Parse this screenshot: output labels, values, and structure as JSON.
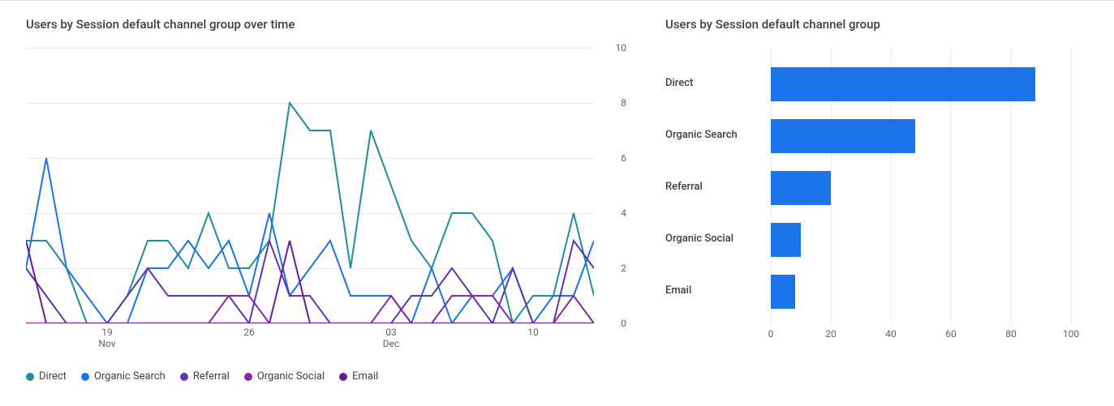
{
  "left": {
    "title": "Users by Session default channel group over time"
  },
  "right": {
    "title": "Users by Session default channel group"
  },
  "legend": {
    "direct": "Direct",
    "organic_search": "Organic Search",
    "referral": "Referral",
    "organic_social": "Organic Social",
    "email": "Email"
  },
  "colors": {
    "direct": "#1e8e9e",
    "organic_search": "#1a73e8",
    "referral": "#5e35b1",
    "organic_social": "#8e24aa",
    "email": "#6a1b9a",
    "bar": "#1a73e8",
    "grid": "#e8eaed",
    "text": "#5f6368"
  },
  "chart_data": [
    {
      "type": "line",
      "title": "Users by Session default channel group over time",
      "xlabel": "",
      "ylabel": "",
      "ylim": [
        0,
        10
      ],
      "y_ticks": [
        0,
        2,
        4,
        6,
        8,
        10
      ],
      "x_ticks": [
        {
          "pos": 4,
          "label": "19",
          "sub": "Nov"
        },
        {
          "pos": 11,
          "label": "26",
          "sub": ""
        },
        {
          "pos": 18,
          "label": "03",
          "sub": "Dec"
        },
        {
          "pos": 25,
          "label": "10",
          "sub": ""
        }
      ],
      "n_points": 29,
      "series": [
        {
          "name": "Direct",
          "color": "#1e8e9e",
          "values": [
            3,
            3,
            2,
            0,
            0,
            1,
            3,
            3,
            2,
            4,
            2,
            2,
            3,
            8,
            7,
            7,
            2,
            7,
            5,
            3,
            2,
            4,
            4,
            3,
            0,
            1,
            1,
            4,
            1
          ]
        },
        {
          "name": "Organic Search",
          "color": "#1a73e8",
          "values": [
            2,
            6,
            2,
            1,
            0,
            0,
            2,
            2,
            3,
            2,
            3,
            1,
            4,
            1,
            2,
            3,
            1,
            1,
            1,
            0,
            2,
            0,
            1,
            1,
            2,
            0,
            1,
            1,
            3
          ]
        },
        {
          "name": "Referral",
          "color": "#5e35b1",
          "values": [
            2,
            1,
            0,
            0,
            0,
            1,
            2,
            1,
            1,
            1,
            1,
            0,
            3,
            1,
            1,
            0,
            0,
            0,
            0,
            1,
            1,
            2,
            1,
            0,
            2,
            0,
            0,
            3,
            2
          ]
        },
        {
          "name": "Organic Social",
          "color": "#8e24aa",
          "values": [
            0,
            0,
            0,
            0,
            0,
            0,
            0,
            0,
            0,
            0,
            1,
            1,
            0,
            0,
            0,
            0,
            0,
            0,
            1,
            0,
            0,
            1,
            1,
            1,
            0,
            0,
            0,
            1,
            0
          ]
        },
        {
          "name": "Email",
          "color": "#6a1b9a",
          "values": [
            3,
            0,
            0,
            0,
            0,
            0,
            0,
            0,
            0,
            0,
            0,
            0,
            0,
            3,
            0,
            0,
            0,
            0,
            0,
            0,
            0,
            0,
            0,
            0,
            0,
            0,
            0,
            0,
            0
          ]
        }
      ]
    },
    {
      "type": "bar",
      "orientation": "horizontal",
      "title": "Users by Session default channel group",
      "xlabel": "",
      "ylabel": "",
      "xlim": [
        0,
        100
      ],
      "x_ticks": [
        0,
        20,
        40,
        60,
        80,
        100
      ],
      "categories": [
        "Direct",
        "Organic Search",
        "Referral",
        "Organic Social",
        "Email"
      ],
      "values": [
        88,
        48,
        20,
        10,
        8
      ]
    }
  ]
}
